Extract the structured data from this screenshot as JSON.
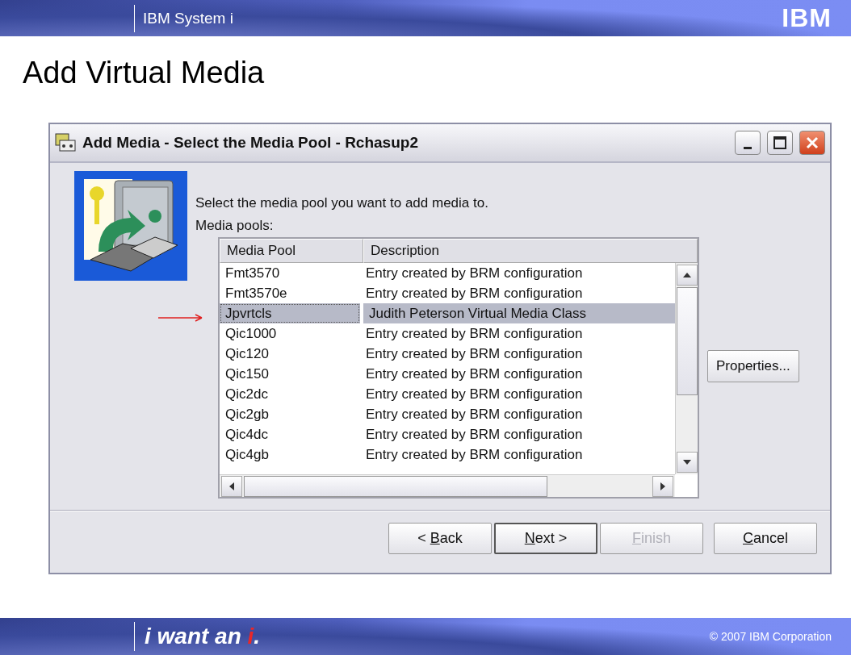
{
  "header": {
    "product": "IBM System i",
    "logo": "IBM"
  },
  "slide_title": "Add Virtual Media",
  "window": {
    "title": "Add Media - Select the Media Pool - Rchasup2",
    "prompt": "Select the media pool you want to add media to.",
    "list_label": "Media pools:",
    "table": {
      "columns": [
        "Media Pool",
        "Description"
      ],
      "rows": [
        {
          "pool": "Fmt3570",
          "description": "Entry created by BRM configuration",
          "selected": false
        },
        {
          "pool": "Fmt3570e",
          "description": "Entry created by BRM configuration",
          "selected": false
        },
        {
          "pool": "Jpvrtcls",
          "description": "Judith Peterson Virtual Media Class",
          "selected": true
        },
        {
          "pool": "Qic1000",
          "description": "Entry created by BRM configuration",
          "selected": false
        },
        {
          "pool": "Qic120",
          "description": "Entry created by BRM configuration",
          "selected": false
        },
        {
          "pool": "Qic150",
          "description": "Entry created by BRM configuration",
          "selected": false
        },
        {
          "pool": "Qic2dc",
          "description": "Entry created by BRM configuration",
          "selected": false
        },
        {
          "pool": "Qic2gb",
          "description": "Entry created by BRM configuration",
          "selected": false
        },
        {
          "pool": "Qic4dc",
          "description": "Entry created by BRM configuration",
          "selected": false
        },
        {
          "pool": "Qic4gb",
          "description": "Entry created by BRM configuration",
          "selected": false
        }
      ]
    },
    "properties_button": "Properties...",
    "buttons": [
      {
        "pre": "< ",
        "key": "B",
        "post": "ack",
        "default": false,
        "disabled": false
      },
      {
        "key": "N",
        "post": "ext >",
        "default": true,
        "disabled": false
      },
      {
        "key": "F",
        "post": "inish",
        "default": false,
        "disabled": true
      },
      {
        "key": "C",
        "post": "ancel",
        "default": false,
        "disabled": false
      }
    ]
  },
  "footer": {
    "tagline": [
      "i want an ",
      "i",
      "."
    ],
    "copyright": "© 2007 IBM Corporation"
  }
}
